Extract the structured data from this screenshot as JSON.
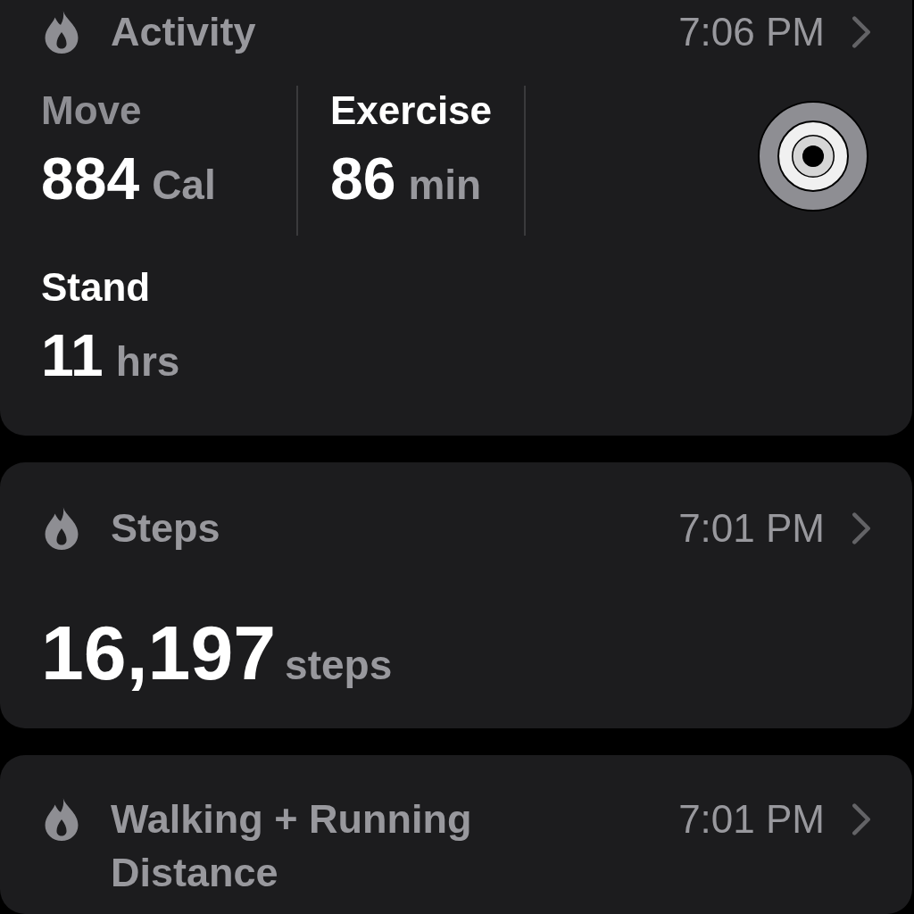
{
  "cards": [
    {
      "kind": "activity",
      "title": "Activity",
      "time": "7:06 PM",
      "metrics": [
        {
          "label": "Move",
          "value": "884",
          "unit": "Cal",
          "dimmed": true
        },
        {
          "label": "Exercise",
          "value": "86",
          "unit": "min",
          "dimmed": false
        },
        {
          "label": "Stand",
          "value": "11",
          "unit": "hrs",
          "dimmed": false
        }
      ]
    },
    {
      "kind": "single",
      "title": "Steps",
      "time": "7:01 PM",
      "value": "16,197",
      "unit": "steps"
    },
    {
      "kind": "title_only",
      "title": "Walking + Running Distance",
      "time": "7:01 PM"
    }
  ]
}
